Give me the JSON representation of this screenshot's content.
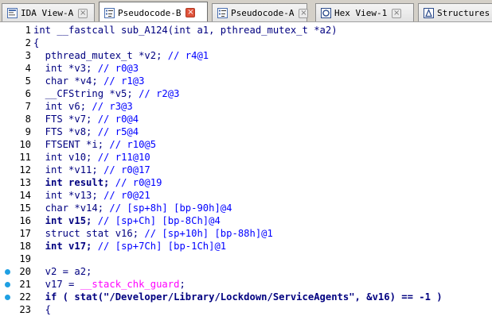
{
  "tabs": [
    {
      "label": "IDA View-A",
      "icon": "ida-view-icon",
      "active": false
    },
    {
      "label": "Pseudocode-B",
      "icon": "pseudocode-icon",
      "active": true
    },
    {
      "label": "Pseudocode-A",
      "icon": "pseudocode-icon",
      "active": false
    },
    {
      "label": "Hex View-1",
      "icon": "hex-view-icon",
      "active": false
    },
    {
      "label": "Structures",
      "icon": "structures-icon",
      "active": false
    }
  ],
  "close_glyph": "×",
  "colors": {
    "keyword": "#000080",
    "comment": "#0000ff",
    "global": "#ff00ff",
    "breakpoint": "#1fa0e3",
    "active_close": "#e0533b"
  },
  "code_lines": [
    {
      "num": "1",
      "bp": false,
      "tokens": [
        {
          "t": "int __fastcall sub_A124(int a1, pthread_mutex_t *a2)",
          "c": "pl"
        }
      ]
    },
    {
      "num": "2",
      "bp": false,
      "tokens": [
        {
          "t": "{",
          "c": "pl"
        }
      ]
    },
    {
      "num": "3",
      "bp": false,
      "tokens": [
        {
          "t": "  pthread_mutex_t *v2; ",
          "c": "pl"
        },
        {
          "t": "// r4@1",
          "c": "cm"
        }
      ]
    },
    {
      "num": "4",
      "bp": false,
      "tokens": [
        {
          "t": "  int *v3; ",
          "c": "pl"
        },
        {
          "t": "// r0@3",
          "c": "cm"
        }
      ]
    },
    {
      "num": "5",
      "bp": false,
      "tokens": [
        {
          "t": "  char *v4; ",
          "c": "pl"
        },
        {
          "t": "// r1@3",
          "c": "cm"
        }
      ]
    },
    {
      "num": "6",
      "bp": false,
      "tokens": [
        {
          "t": "  __CFString *v5; ",
          "c": "pl"
        },
        {
          "t": "// r2@3",
          "c": "cm"
        }
      ]
    },
    {
      "num": "7",
      "bp": false,
      "tokens": [
        {
          "t": "  int v6; ",
          "c": "pl"
        },
        {
          "t": "// r3@3",
          "c": "cm"
        }
      ]
    },
    {
      "num": "8",
      "bp": false,
      "tokens": [
        {
          "t": "  FTS *v7; ",
          "c": "pl"
        },
        {
          "t": "// r0@4",
          "c": "cm"
        }
      ]
    },
    {
      "num": "9",
      "bp": false,
      "tokens": [
        {
          "t": "  FTS *v8; ",
          "c": "pl"
        },
        {
          "t": "// r5@4",
          "c": "cm"
        }
      ]
    },
    {
      "num": "10",
      "bp": false,
      "tokens": [
        {
          "t": "  FTSENT *i; ",
          "c": "pl"
        },
        {
          "t": "// r10@5",
          "c": "cm"
        }
      ]
    },
    {
      "num": "11",
      "bp": false,
      "tokens": [
        {
          "t": "  int v10; ",
          "c": "pl"
        },
        {
          "t": "// r11@10",
          "c": "cm"
        }
      ]
    },
    {
      "num": "12",
      "bp": false,
      "tokens": [
        {
          "t": "  int *v11; ",
          "c": "pl"
        },
        {
          "t": "// r0@17",
          "c": "cm"
        }
      ]
    },
    {
      "num": "13",
      "bp": false,
      "tokens": [
        {
          "t": "  int result; ",
          "c": "bold"
        },
        {
          "t": "// r0@19",
          "c": "cm"
        }
      ]
    },
    {
      "num": "14",
      "bp": false,
      "tokens": [
        {
          "t": "  int *v13; ",
          "c": "pl"
        },
        {
          "t": "// r0@21",
          "c": "cm"
        }
      ]
    },
    {
      "num": "15",
      "bp": false,
      "tokens": [
        {
          "t": "  char *v14; ",
          "c": "pl"
        },
        {
          "t": "// [sp+8h] [bp-90h]@4",
          "c": "cm"
        }
      ]
    },
    {
      "num": "16",
      "bp": false,
      "tokens": [
        {
          "t": "  int v15; ",
          "c": "bold"
        },
        {
          "t": "// [sp+Ch] [bp-8Ch]@4",
          "c": "cm"
        }
      ]
    },
    {
      "num": "17",
      "bp": false,
      "tokens": [
        {
          "t": "  struct stat v16; ",
          "c": "pl"
        },
        {
          "t": "// [sp+10h] [bp-88h]@1",
          "c": "cm"
        }
      ]
    },
    {
      "num": "18",
      "bp": false,
      "tokens": [
        {
          "t": "  int v17; ",
          "c": "bold"
        },
        {
          "t": "// [sp+7Ch] [bp-1Ch]@1",
          "c": "cm"
        }
      ]
    },
    {
      "num": "19",
      "bp": false,
      "tokens": [
        {
          "t": "",
          "c": "pl"
        }
      ]
    },
    {
      "num": "20",
      "bp": true,
      "tokens": [
        {
          "t": "  v2 = a2;",
          "c": "pl"
        }
      ]
    },
    {
      "num": "21",
      "bp": true,
      "tokens": [
        {
          "t": "  v17 = ",
          "c": "pl"
        },
        {
          "t": "__stack_chk_guard",
          "c": "mag"
        },
        {
          "t": ";",
          "c": "pl"
        }
      ]
    },
    {
      "num": "22",
      "bp": true,
      "tokens": [
        {
          "t": "  if ( stat(\"/Developer/Library/Lockdown/ServiceAgents\", &v16) == -1 )",
          "c": "bold"
        }
      ]
    },
    {
      "num": "23",
      "bp": false,
      "tokens": [
        {
          "t": "  {",
          "c": "pl"
        }
      ]
    }
  ]
}
